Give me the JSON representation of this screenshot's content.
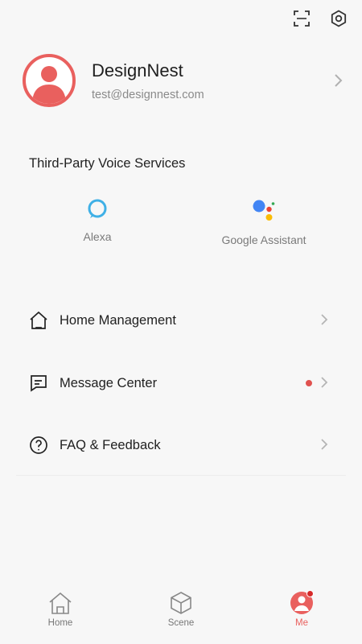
{
  "topbar": {
    "scan_icon": "scan-icon",
    "settings_icon": "settings-hex-icon"
  },
  "profile": {
    "name": "DesignNest",
    "email": "test@designnest.com"
  },
  "voice_services": {
    "title": "Third-Party Voice Services",
    "items": [
      {
        "label": "Alexa",
        "icon": "alexa-icon",
        "color": "#3fb0e6"
      },
      {
        "label": "Google Assistant",
        "icon": "google-assistant-icon"
      }
    ]
  },
  "menu": [
    {
      "label": "Home Management",
      "icon": "house-icon",
      "has_dot": false
    },
    {
      "label": "Message Center",
      "icon": "message-icon",
      "has_dot": true
    },
    {
      "label": "FAQ & Feedback",
      "icon": "help-icon",
      "has_dot": false
    }
  ],
  "tabs": [
    {
      "label": "Home",
      "icon": "home-icon",
      "active": false
    },
    {
      "label": "Scene",
      "icon": "scene-cube-icon",
      "active": false
    },
    {
      "label": "Me",
      "icon": "me-icon",
      "active": true,
      "badge": true
    }
  ],
  "colors": {
    "accent": "#e9605e",
    "badge": "#d62a2a",
    "alexa": "#3fb0e6"
  }
}
